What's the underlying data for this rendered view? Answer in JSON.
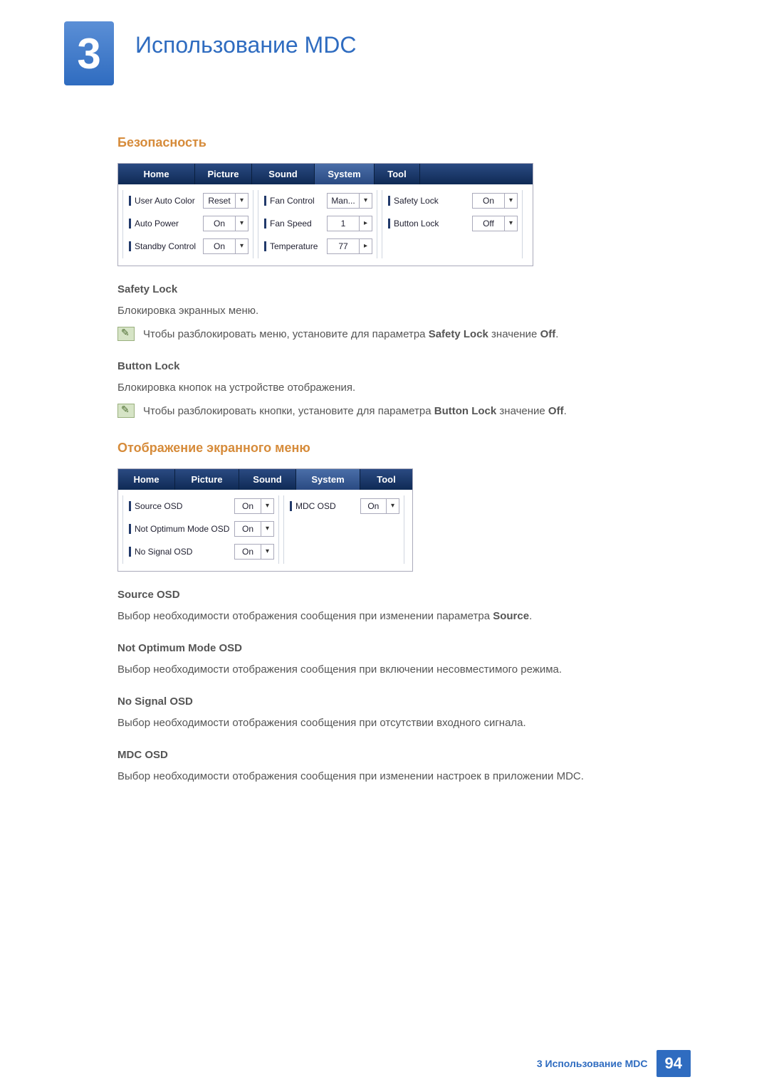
{
  "chapter": {
    "number": "3",
    "title": "Использование MDC"
  },
  "footer": {
    "text": "3 Использование MDC",
    "page": "94"
  },
  "security": {
    "heading": "Безопасность",
    "panel": {
      "tabs": [
        "Home",
        "Picture",
        "Sound",
        "System",
        "Tool"
      ],
      "selected_tab": 3,
      "col1": [
        {
          "label": "User Auto Color",
          "value": "Reset"
        },
        {
          "label": "Auto Power",
          "value": "On"
        },
        {
          "label": "Standby Control",
          "value": "On"
        }
      ],
      "col2": [
        {
          "label": "Fan Control",
          "value": "Man...",
          "arrow": "▾"
        },
        {
          "label": "Fan Speed",
          "value": "1",
          "arrow": "▸"
        },
        {
          "label": "Temperature",
          "value": "77",
          "arrow": "▸"
        }
      ],
      "col3": [
        {
          "label": "Safety Lock",
          "value": "On"
        },
        {
          "label": "Button Lock",
          "value": "Off"
        }
      ]
    },
    "safety_lock": {
      "title": "Safety Lock",
      "text": "Блокировка экранных меню.",
      "note_pre": "Чтобы разблокировать меню, установите для параметра ",
      "note_bold1": "Safety Lock",
      "note_mid": " значение ",
      "note_bold2": "Off",
      "note_post": "."
    },
    "button_lock": {
      "title": "Button Lock",
      "text": "Блокировка кнопок на устройстве отображения.",
      "note_pre": "Чтобы разблокировать кнопки, установите для параметра ",
      "note_bold1": "Button Lock",
      "note_mid": " значение ",
      "note_bold2": "Off",
      "note_post": "."
    }
  },
  "osd": {
    "heading": "Отображение экранного меню",
    "panel": {
      "tabs": [
        "Home",
        "Picture",
        "Sound",
        "System",
        "Tool"
      ],
      "selected_tab": 3,
      "col1": [
        {
          "label": "Source OSD",
          "value": "On"
        },
        {
          "label": "Not Optimum Mode OSD",
          "value": "On"
        },
        {
          "label": "No Signal OSD",
          "value": "On"
        }
      ],
      "col2": [
        {
          "label": "MDC OSD",
          "value": "On"
        }
      ]
    },
    "source_osd": {
      "title": "Source OSD",
      "pre": "Выбор необходимости отображения сообщения при изменении параметра ",
      "bold": "Source",
      "post": "."
    },
    "not_optimum": {
      "title": "Not Optimum Mode OSD",
      "text": "Выбор необходимости отображения сообщения при включении несовместимого режима."
    },
    "no_signal": {
      "title": "No Signal OSD",
      "text": "Выбор необходимости отображения сообщения при отсутствии входного сигнала."
    },
    "mdc_osd": {
      "title": "MDC OSD",
      "text": "Выбор необходимости отображения сообщения при изменении настроек в приложении MDC."
    }
  }
}
